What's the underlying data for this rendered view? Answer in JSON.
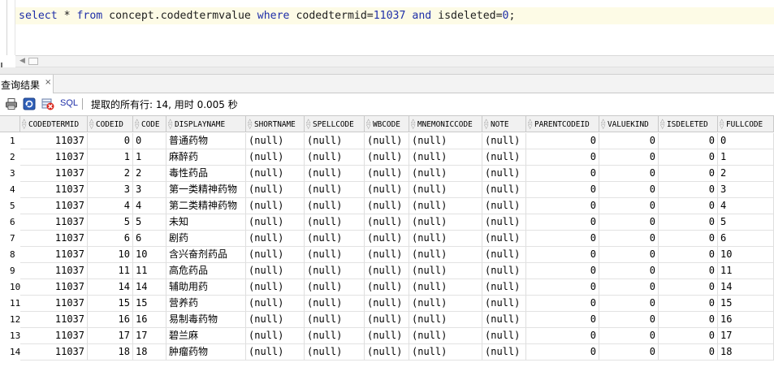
{
  "editor": {
    "sql_parts": [
      {
        "t": "select",
        "c": "kw"
      },
      {
        "t": " * ",
        "c": ""
      },
      {
        "t": "from",
        "c": "kw"
      },
      {
        "t": " concept.codedtermvalue ",
        "c": ""
      },
      {
        "t": "where",
        "c": "kw"
      },
      {
        "t": " codedtermid=",
        "c": ""
      },
      {
        "t": "11037",
        "c": "num"
      },
      {
        "t": " ",
        "c": ""
      },
      {
        "t": "and",
        "c": "kw"
      },
      {
        "t": " isdeleted=",
        "c": ""
      },
      {
        "t": "0",
        "c": "num"
      },
      {
        "t": ";",
        "c": ""
      }
    ]
  },
  "result_tab": {
    "label": "查询结果",
    "close": "×"
  },
  "toolbar": {
    "print_icon": "printer-icon",
    "refresh_icon": "refresh-icon",
    "cancel_icon": "cancel-icon",
    "sql_label": "SQL",
    "status": "提取的所有行: 14, 用时 0.005 秒"
  },
  "grid": {
    "columns": [
      "CODEDTERMID",
      "CODEID",
      "CODE",
      "DISPLAYNAME",
      "SHORTNAME",
      "SPELLCODE",
      "WBCODE",
      "MNEMONICCODE",
      "NOTE",
      "PARENTCODEID",
      "VALUEKIND",
      "ISDELETED",
      "FULLCODE"
    ],
    "rows": [
      [
        "11037",
        "0",
        "0",
        "普通药物",
        "(null)",
        "(null)",
        "(null)",
        "(null)",
        "(null)",
        "0",
        "0",
        "0",
        "0"
      ],
      [
        "11037",
        "1",
        "1",
        "麻醉药",
        "(null)",
        "(null)",
        "(null)",
        "(null)",
        "(null)",
        "0",
        "0",
        "0",
        "1"
      ],
      [
        "11037",
        "2",
        "2",
        "毒性药品",
        "(null)",
        "(null)",
        "(null)",
        "(null)",
        "(null)",
        "0",
        "0",
        "0",
        "2"
      ],
      [
        "11037",
        "3",
        "3",
        "第一类精神药物",
        "(null)",
        "(null)",
        "(null)",
        "(null)",
        "(null)",
        "0",
        "0",
        "0",
        "3"
      ],
      [
        "11037",
        "4",
        "4",
        "第二类精神药物",
        "(null)",
        "(null)",
        "(null)",
        "(null)",
        "(null)",
        "0",
        "0",
        "0",
        "4"
      ],
      [
        "11037",
        "5",
        "5",
        "未知",
        "(null)",
        "(null)",
        "(null)",
        "(null)",
        "(null)",
        "0",
        "0",
        "0",
        "5"
      ],
      [
        "11037",
        "6",
        "6",
        "剧药",
        "(null)",
        "(null)",
        "(null)",
        "(null)",
        "(null)",
        "0",
        "0",
        "0",
        "6"
      ],
      [
        "11037",
        "10",
        "10",
        "含兴奋剂药品",
        "(null)",
        "(null)",
        "(null)",
        "(null)",
        "(null)",
        "0",
        "0",
        "0",
        "10"
      ],
      [
        "11037",
        "11",
        "11",
        "高危药品",
        "(null)",
        "(null)",
        "(null)",
        "(null)",
        "(null)",
        "0",
        "0",
        "0",
        "11"
      ],
      [
        "11037",
        "14",
        "14",
        "辅助用药",
        "(null)",
        "(null)",
        "(null)",
        "(null)",
        "(null)",
        "0",
        "0",
        "0",
        "14"
      ],
      [
        "11037",
        "15",
        "15",
        "营养药",
        "(null)",
        "(null)",
        "(null)",
        "(null)",
        "(null)",
        "0",
        "0",
        "0",
        "15"
      ],
      [
        "11037",
        "16",
        "16",
        "易制毒药物",
        "(null)",
        "(null)",
        "(null)",
        "(null)",
        "(null)",
        "0",
        "0",
        "0",
        "16"
      ],
      [
        "11037",
        "17",
        "17",
        "碧兰麻",
        "(null)",
        "(null)",
        "(null)",
        "(null)",
        "(null)",
        "0",
        "0",
        "0",
        "17"
      ],
      [
        "11037",
        "18",
        "18",
        "肿瘤药物",
        "(null)",
        "(null)",
        "(null)",
        "(null)",
        "(null)",
        "0",
        "0",
        "0",
        "18"
      ]
    ]
  }
}
